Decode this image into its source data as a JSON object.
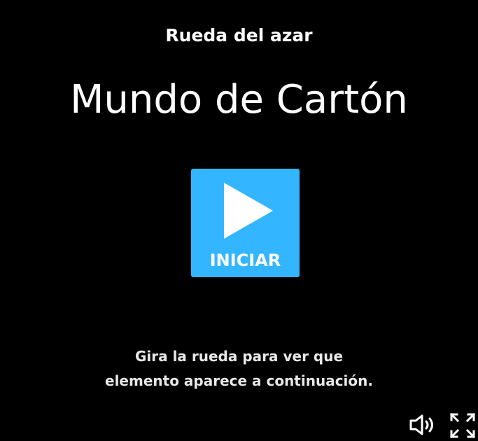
{
  "activity": {
    "subtitle": "Rueda del azar",
    "title": "Mundo de Cartón"
  },
  "start_button": {
    "label": "INICIAR",
    "icon": "play-icon",
    "color": "#33b6ff"
  },
  "instructions": {
    "line1": "Gira la rueda para ver que",
    "line2": "elemento aparece a continuación."
  },
  "controls": {
    "sound_icon": "speaker-icon",
    "fullscreen_icon": "fullscreen-icon"
  },
  "colors": {
    "background": "#000000",
    "text": "#ffffff",
    "accent": "#33b6ff"
  }
}
